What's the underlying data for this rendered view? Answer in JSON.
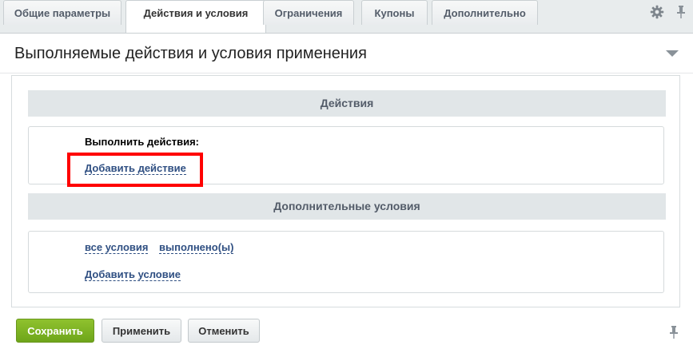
{
  "tabs": [
    {
      "label": "Общие параметры",
      "active": false
    },
    {
      "label": "Действия и условия",
      "active": true
    },
    {
      "label": "Ограничения",
      "active": false
    },
    {
      "label": "Купоны",
      "active": false
    },
    {
      "label": "Дополнительно",
      "active": false
    }
  ],
  "panel": {
    "title": "Выполняемые действия и условия применения"
  },
  "actions": {
    "header": "Действия",
    "execute_label": "Выполнить действия:",
    "add_action_link": "Добавить действие"
  },
  "conditions": {
    "header": "Дополнительные условия",
    "all_conditions_link": "все условия",
    "fulfilled_link": "выполнено(ы)",
    "add_condition_link": "Добавить условие"
  },
  "footer": {
    "save_label": "Сохранить",
    "apply_label": "Применить",
    "cancel_label": "Отменить"
  },
  "icons": {
    "settings": "gear-icon",
    "pin": "pin-icon",
    "collapse": "chevron-down-icon"
  },
  "colors": {
    "save_button": "#7bb31f",
    "link": "#2f4f82",
    "highlight": "#ff0000"
  }
}
